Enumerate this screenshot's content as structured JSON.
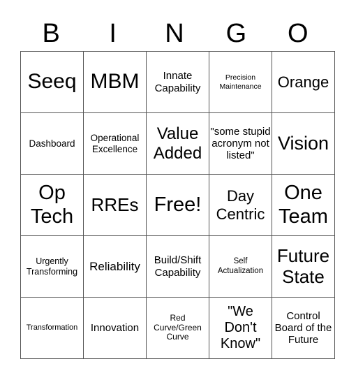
{
  "header": {
    "letters": [
      "B",
      "I",
      "N",
      "G",
      "O"
    ]
  },
  "card": {
    "rows": [
      [
        "Seeq",
        "MBM",
        "Innate Capability",
        "Precision Maintenance",
        "Orange"
      ],
      [
        "Dashboard",
        "Operational Excellence",
        "Value Added",
        "\"some stupid acronym not listed\"",
        "Vision"
      ],
      [
        "Op Tech",
        "RREs",
        "Free!",
        "Day Centric",
        "One Team"
      ],
      [
        "Urgently Transforming",
        "Reliability",
        "Build/Shift Capability",
        "Self Actualization",
        "Future State"
      ],
      [
        "Transformation",
        "Innovation",
        "Red Curve/Green Curve",
        "\"We Don't Know\"",
        "Control Board of the Future"
      ]
    ]
  }
}
